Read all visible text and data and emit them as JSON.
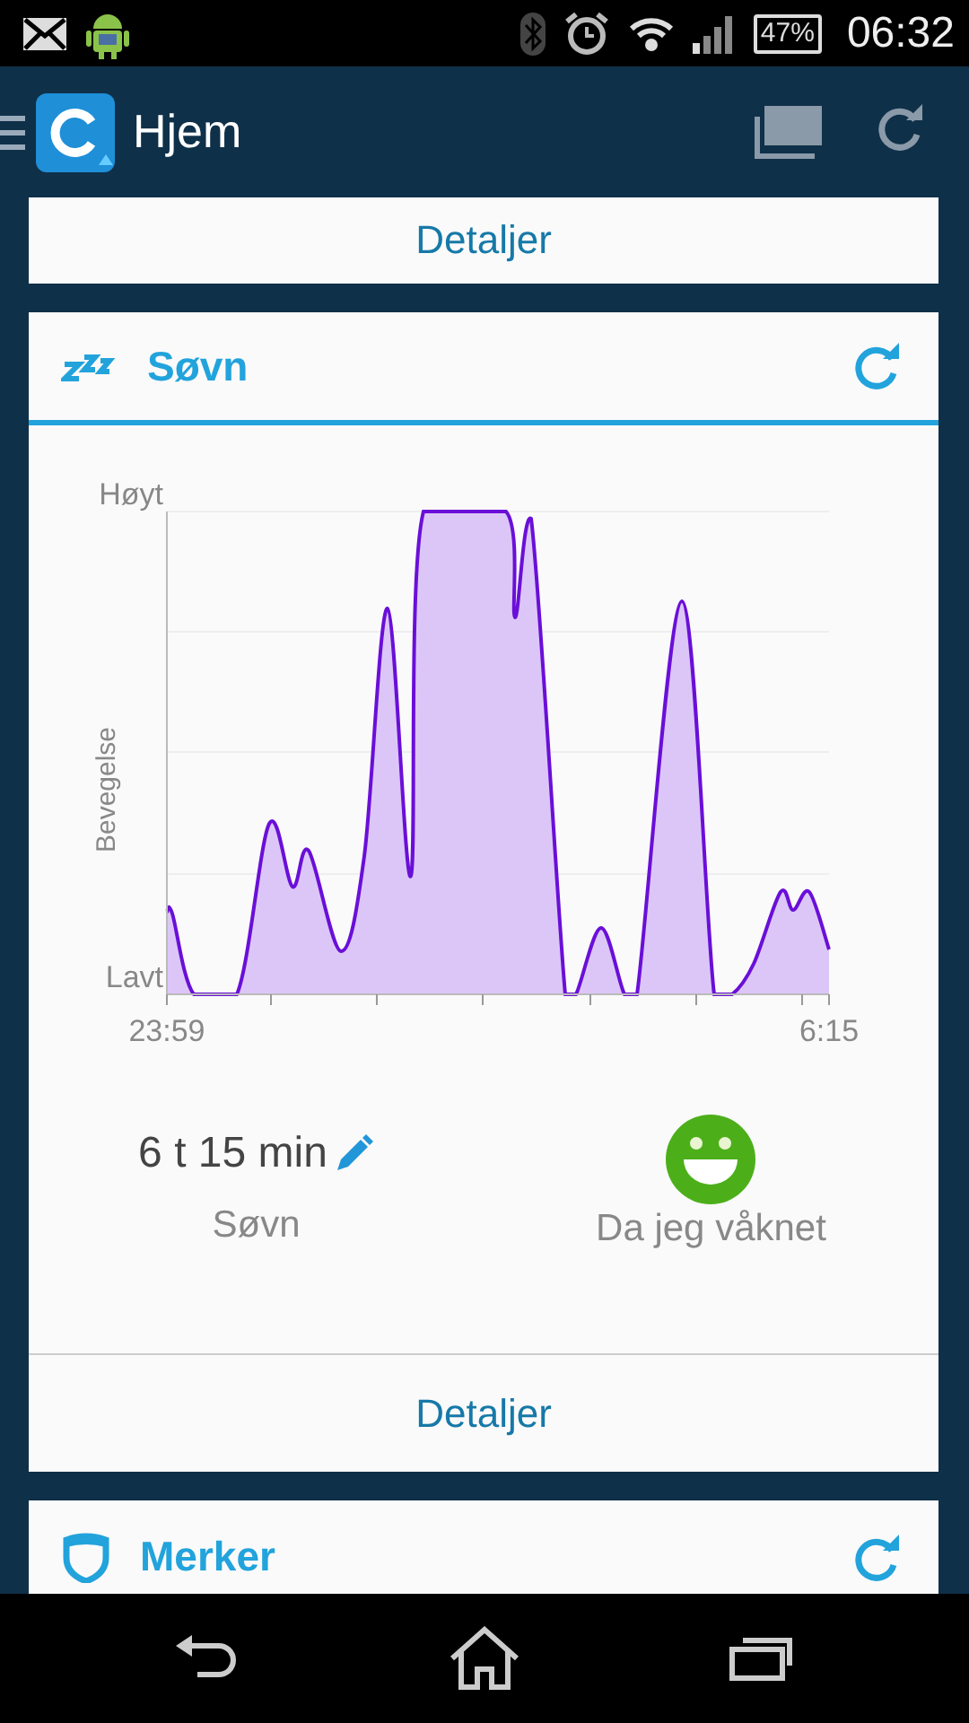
{
  "status_bar": {
    "battery": "47%",
    "time": "06:32"
  },
  "app_bar": {
    "title": "Hjem"
  },
  "top_card": {
    "action": "Detaljer"
  },
  "sleep_card": {
    "title": "Søvn",
    "graph": {
      "ylabel": "Bevegelse",
      "top_label": "Høyt",
      "bottom_label": "Lavt",
      "start_time": "23:59",
      "end_time": "6:15"
    },
    "duration": "6 t 15 min",
    "duration_label": "Søvn",
    "mood_label": "Da jeg våknet",
    "action": "Detaljer"
  },
  "badges_card": {
    "title": "Merker"
  }
}
